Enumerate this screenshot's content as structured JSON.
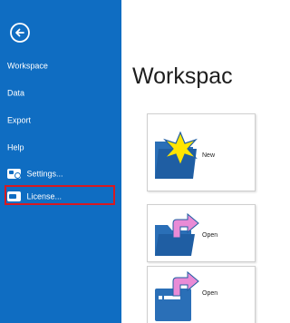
{
  "sidebar": {
    "items": [
      {
        "label": "Workspace"
      },
      {
        "label": "Data"
      },
      {
        "label": "Export"
      },
      {
        "label": "Help"
      },
      {
        "label": "Settings..."
      },
      {
        "label": "License..."
      }
    ]
  },
  "main": {
    "title": "Workspac",
    "cards": [
      {
        "label": "New"
      },
      {
        "label": "Open"
      },
      {
        "label": "Open"
      }
    ]
  },
  "colors": {
    "sidebar": "#0f6dc2",
    "highlight_border": "#d81920",
    "folder": "#2a6fb7",
    "star": "#ffe500",
    "arrow": "#e98bd6"
  }
}
